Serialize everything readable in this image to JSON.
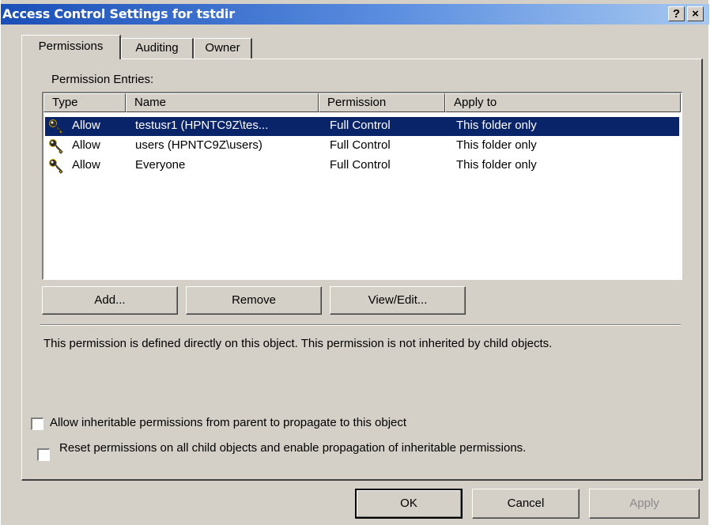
{
  "window": {
    "title": "Access Control Settings for tstdir",
    "help_glyph": "?",
    "close_glyph": "×"
  },
  "tabs": [
    {
      "label": "Permissions",
      "selected": true
    },
    {
      "label": "Auditing",
      "selected": false
    },
    {
      "label": "Owner",
      "selected": false
    }
  ],
  "permissions": {
    "entries_label": "Permission Entries:",
    "columns": [
      "Type",
      "Name",
      "Permission",
      "Apply to"
    ],
    "rows": [
      {
        "icon": "key-icon",
        "type": "Allow",
        "name": "testusr1 (HPNTC9Z\\tes...",
        "permission": "Full Control",
        "apply_to": "This folder only",
        "selected": true
      },
      {
        "icon": "key-icon",
        "type": "Allow",
        "name": "users (HPNTC9Z\\users)",
        "permission": "Full Control",
        "apply_to": "This folder only",
        "selected": false
      },
      {
        "icon": "key-icon",
        "type": "Allow",
        "name": "Everyone",
        "permission": "Full Control",
        "apply_to": "This folder only",
        "selected": false
      }
    ],
    "buttons": {
      "add": "Add...",
      "remove": "Remove",
      "view_edit": "View/Edit..."
    },
    "description": "This permission is defined directly on this object. This permission is not inherited by child objects.",
    "inherit_checkbox": {
      "label": "Allow inheritable permissions from parent to propagate to this object",
      "checked": false
    },
    "reset_checkbox": {
      "label": "Reset permissions on all child objects and enable propagation of inheritable permissions.",
      "checked": false
    }
  },
  "footer": {
    "ok": "OK",
    "cancel": "Cancel",
    "apply": "Apply",
    "apply_enabled": false
  },
  "colors": {
    "title_gradient_start": "#1a4fb8",
    "title_gradient_end": "#a6c8f0",
    "selection": "#0a246a",
    "face": "#d4d0c8"
  }
}
